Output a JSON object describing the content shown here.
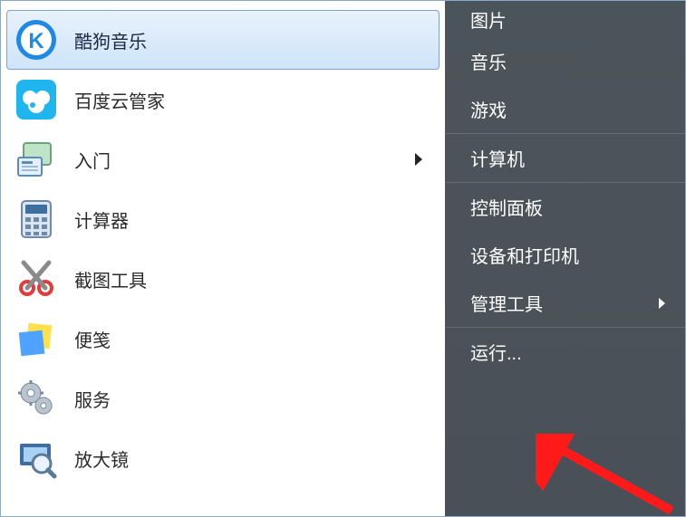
{
  "left_items": [
    {
      "id": "kugou",
      "label": "酷狗音乐",
      "has_submenu": false
    },
    {
      "id": "baidu",
      "label": "百度云管家",
      "has_submenu": false
    },
    {
      "id": "getstarted",
      "label": "入门",
      "has_submenu": true
    },
    {
      "id": "calculator",
      "label": "计算器",
      "has_submenu": false
    },
    {
      "id": "snip",
      "label": "截图工具",
      "has_submenu": false
    },
    {
      "id": "sticky",
      "label": "便笺",
      "has_submenu": false
    },
    {
      "id": "services",
      "label": "服务",
      "has_submenu": false
    },
    {
      "id": "magnifier",
      "label": "放大镜",
      "has_submenu": false
    }
  ],
  "selected_left_index": 0,
  "right_items": [
    {
      "id": "pictures",
      "label": "图片",
      "has_submenu": false
    },
    {
      "id": "music",
      "label": "音乐",
      "has_submenu": false
    },
    {
      "id": "games",
      "label": "游戏",
      "has_submenu": false
    },
    {
      "id": "computer",
      "label": "计算机",
      "has_submenu": false
    },
    {
      "id": "controlpanel",
      "label": "控制面板",
      "has_submenu": false
    },
    {
      "id": "devices",
      "label": "设备和打印机",
      "has_submenu": false
    },
    {
      "id": "admintools",
      "label": "管理工具",
      "has_submenu": true
    },
    {
      "id": "run",
      "label": "运行...",
      "has_submenu": false
    }
  ],
  "right_dividers_after": [
    2,
    3,
    6
  ],
  "icons": {
    "kugou_letter": "K"
  }
}
